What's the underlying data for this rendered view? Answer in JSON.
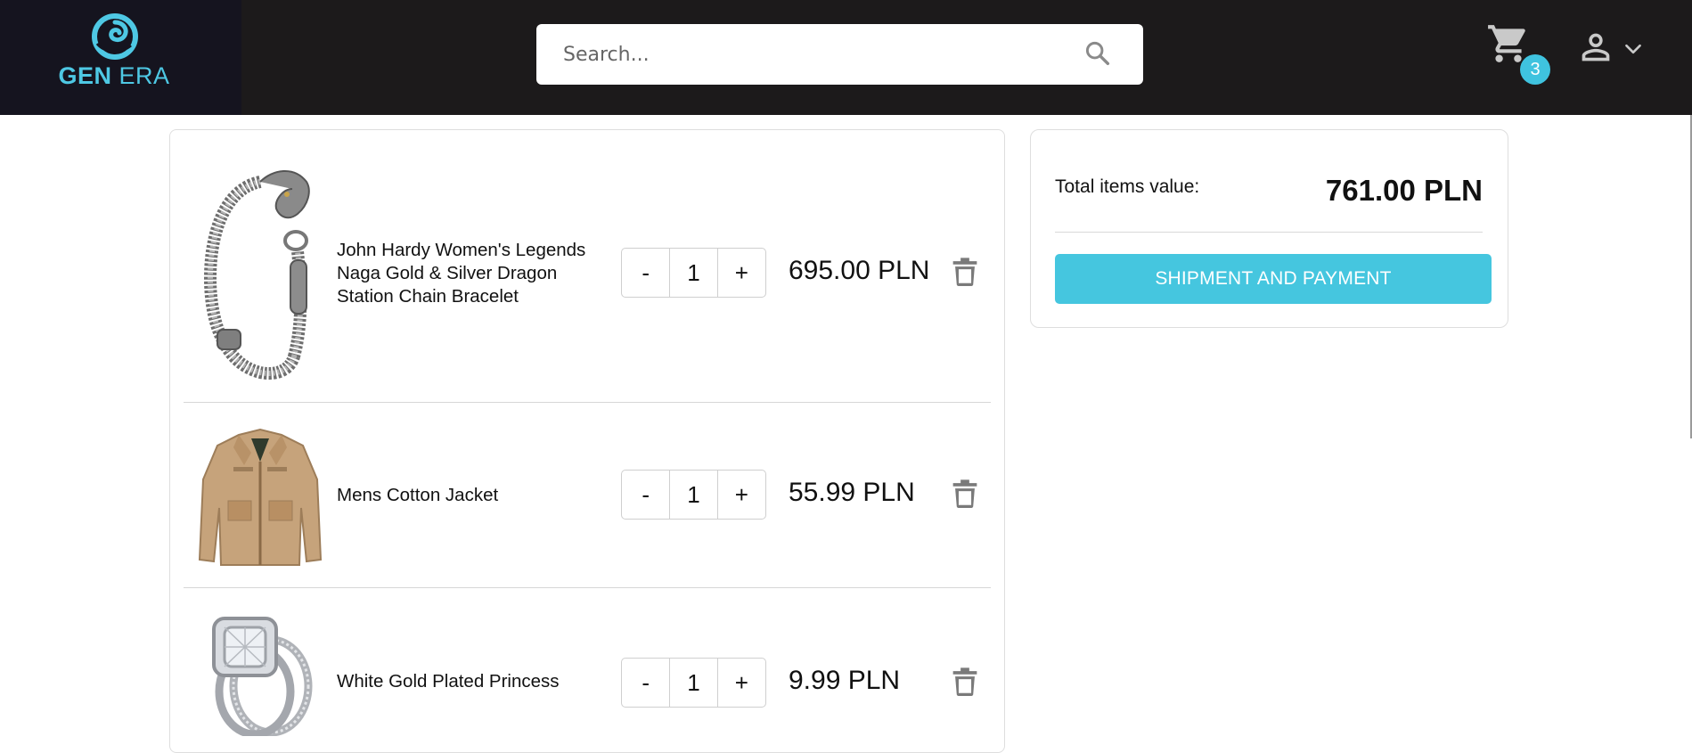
{
  "header": {
    "logo": {
      "word1": "GEN",
      "word2": "ERA",
      "accent": "#4ec8e4"
    },
    "search": {
      "placeholder": "Search...",
      "value": "",
      "icon": "search-icon"
    },
    "cart": {
      "count": "3",
      "icon": "cart-icon"
    },
    "user": {
      "icon": "user-icon",
      "dropdown_icon": "chevron-down-icon"
    }
  },
  "cart": {
    "items": [
      {
        "name": "John Hardy Women's Legends Naga Gold & Silver Dragon Station Chain Bracelet",
        "quantity": "1",
        "minus": "-",
        "plus": "+",
        "price": "695.00 PLN"
      },
      {
        "name": "Mens Cotton Jacket",
        "quantity": "1",
        "minus": "-",
        "plus": "+",
        "price": "55.99 PLN"
      },
      {
        "name": "White Gold Plated Princess",
        "quantity": "1",
        "minus": "-",
        "plus": "+",
        "price": "9.99 PLN"
      }
    ]
  },
  "summary": {
    "total_label": "Total items value:",
    "total_value": "761.00 PLN",
    "button_label": "SHIPMENT AND PAYMENT",
    "button_color": "#45c6df"
  }
}
